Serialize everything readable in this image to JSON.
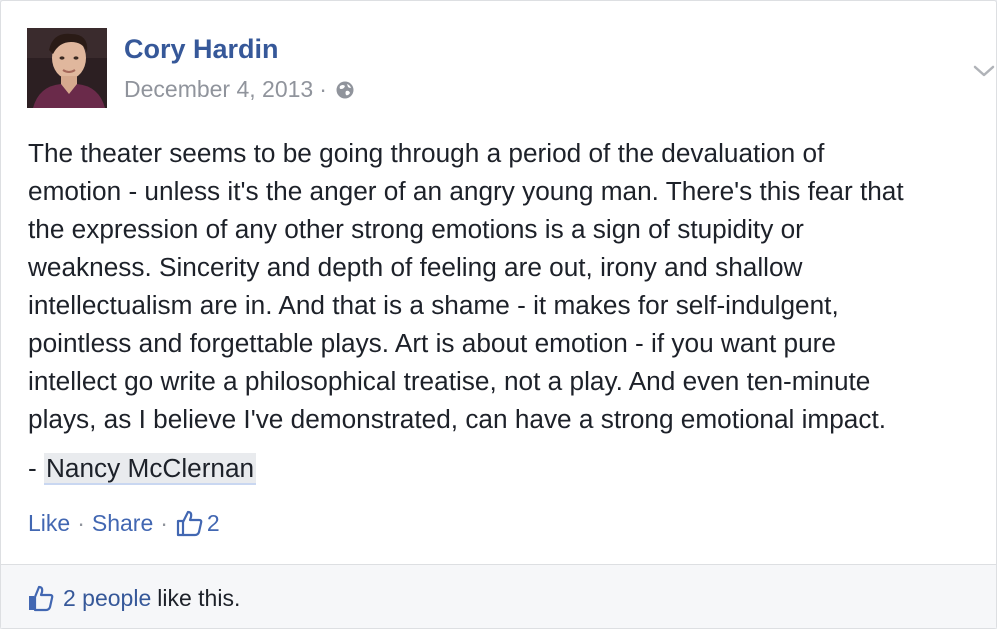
{
  "post": {
    "author": "Cory Hardin",
    "date": "December 4, 2013",
    "meta_separator": "·",
    "privacy_icon": "globe-icon",
    "options_icon": "chevron-down-icon",
    "avatar_icon": "profile-photo",
    "body_lines": [
      "The theater seems to be going through a period of the devaluation of",
      "emotion - unless it's the anger of an angry young man. There's this fear that",
      "the expression of any other strong emotions is a sign of stupidity or",
      "weakness. Sincerity and depth of feeling are out, irony and shallow",
      "intellectualism are in. And that is a shame - it makes for self-indulgent,",
      "pointless and forgettable plays. Art is about emotion - if you want pure",
      "intellect go write a philosophical treatise, not a play. And even ten-minute",
      "plays, as I believe I've demonstrated, can have a strong emotional impact."
    ],
    "signature_prefix": "- ",
    "signature_name": "Nancy McClernan"
  },
  "actions": {
    "like_label": "Like",
    "share_label": "Share",
    "separator": "·",
    "like_count": "2",
    "like_icon": "thumbs-up-icon"
  },
  "footer": {
    "likes_link": "2 people",
    "likes_suffix": "like this.",
    "like_icon": "thumbs-up-icon"
  },
  "colors": {
    "link": "#365899",
    "action_link": "#4267b2",
    "meta_text": "#90949c",
    "body_text": "#1d2129",
    "footer_bg": "#f6f7f9"
  }
}
